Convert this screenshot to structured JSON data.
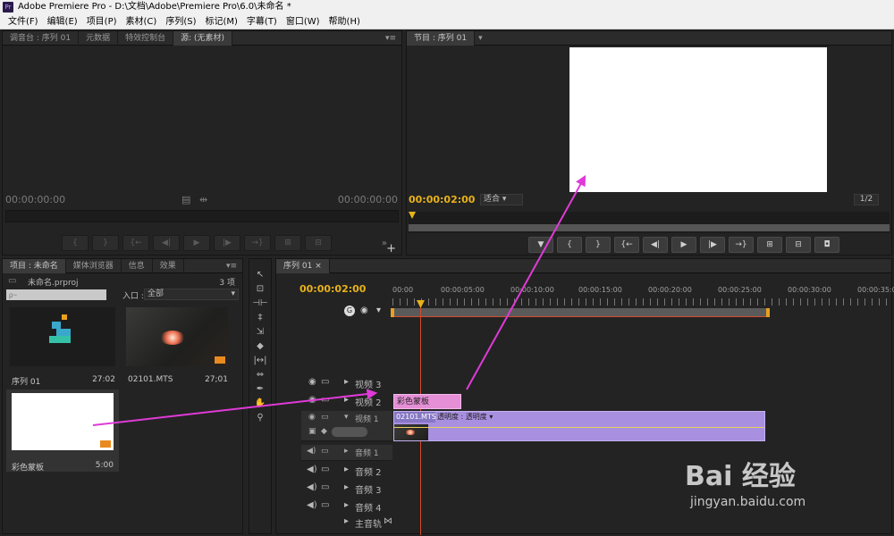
{
  "window": {
    "title": "Adobe Premiere Pro - D:\\文档\\Adobe\\Premiere Pro\\6.0\\未命名 *"
  },
  "menu": [
    "文件(F)",
    "编辑(E)",
    "项目(P)",
    "素材(C)",
    "序列(S)",
    "标记(M)",
    "字幕(T)",
    "窗口(W)",
    "帮助(H)"
  ],
  "source_panel": {
    "tabs": [
      "调音台 : 序列 01",
      "元数据",
      "特效控制台",
      "源: (无素材)"
    ],
    "timecode_left": "00:00:00:00",
    "timecode_right": "00:00:00:00"
  },
  "program_panel": {
    "tab": "节目 : 序列 01",
    "timecode": "00:00:02:00",
    "fit": "适合",
    "ratio": "1/2"
  },
  "project_panel": {
    "tabs": [
      "项目 : 未命名",
      "媒体浏览器",
      "信息",
      "效果"
    ],
    "filename": "未命名.prproj",
    "count": "3 项",
    "search_placeholder": "ρ~",
    "inlet_label": "入口 :",
    "inlet_value": "全部",
    "items": [
      {
        "name": "序列 01",
        "duration": "27:02"
      },
      {
        "name": "02101.MTS",
        "duration": "27;01"
      },
      {
        "name": "彩色蒙板",
        "duration": "5:00"
      }
    ]
  },
  "timeline": {
    "tab": "序列 01",
    "timecode": "00:00:02:00",
    "ruler": [
      "00:00",
      "00:00:05:00",
      "00:00:10:00",
      "00:00:15:00",
      "00:00:20:00",
      "00:00:25:00",
      "00:00:30:00",
      "00:00:35:00"
    ],
    "video_tracks": [
      "视频 3",
      "视频 2",
      "视频 1"
    ],
    "audio_tracks": [
      "音频 1",
      "音频 2",
      "音频 3",
      "音频 4"
    ],
    "master_track": "主音轨",
    "clip_v2": "彩色蒙板",
    "clip_v1_name": "02101.MTS",
    "clip_v1_fx": "透明度 : 透明度 ▾"
  },
  "watermark": {
    "brand": "Bai 经验",
    "url": "jingyan.baidu.com"
  },
  "colors": {
    "accent": "#e8b21a",
    "playhead": "#d34a2c",
    "clip_pink": "#e58fd6",
    "clip_purple": "#a98fe0",
    "arrow": "#e03ad8"
  }
}
